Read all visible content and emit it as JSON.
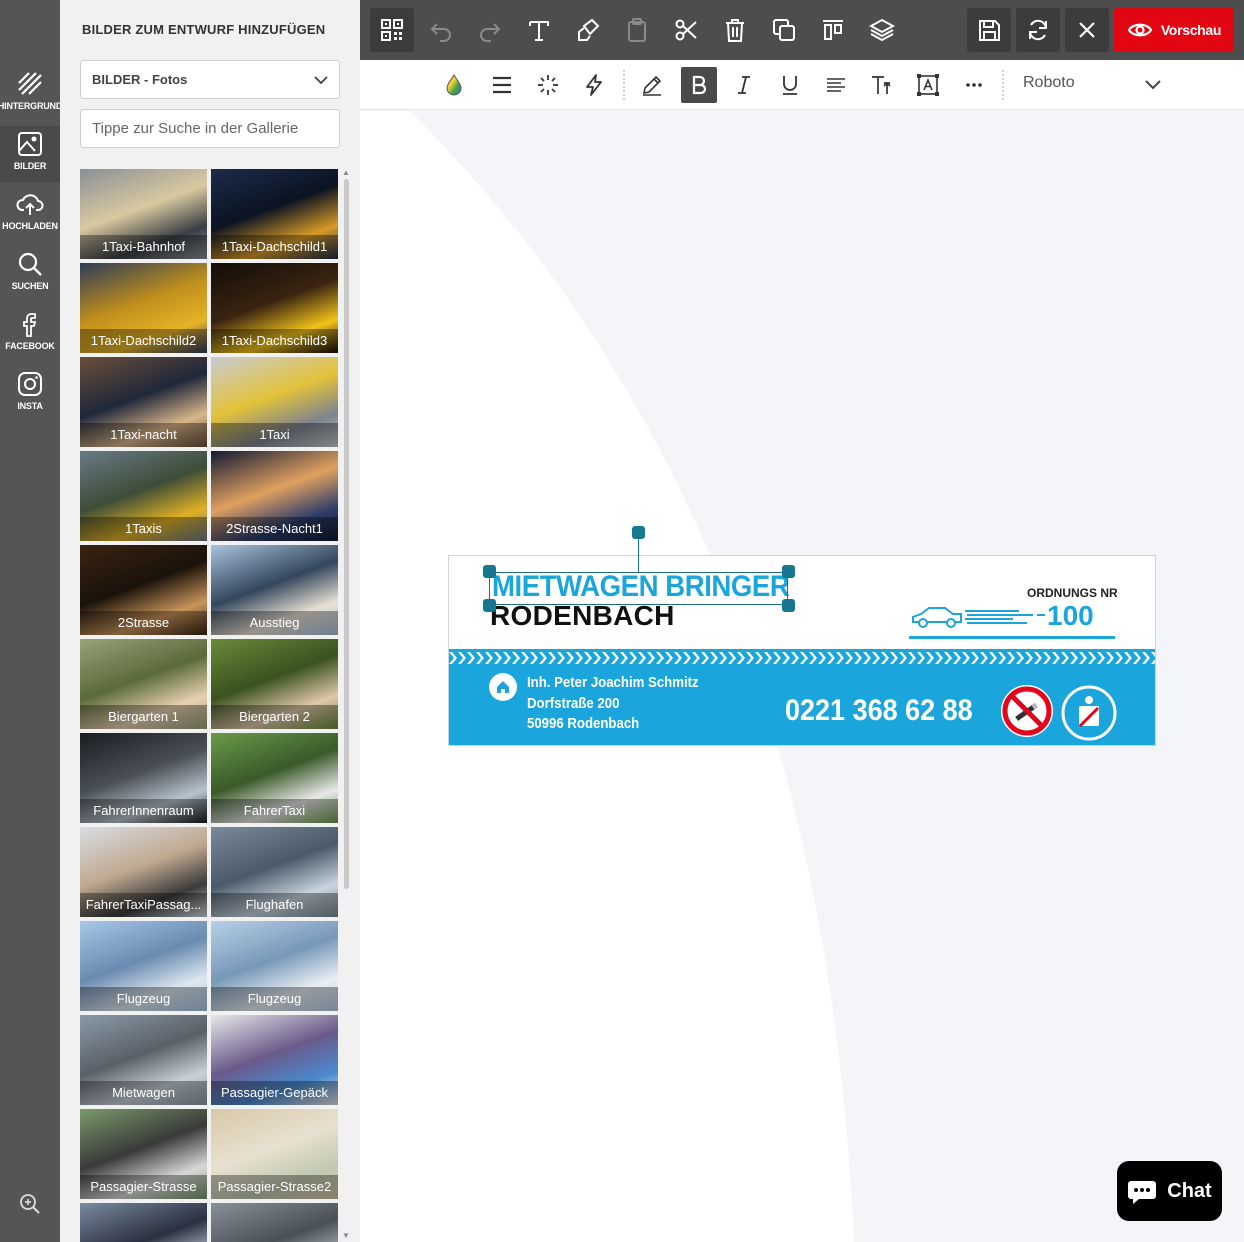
{
  "rail": {
    "items": [
      {
        "label": "HINTERGRUND",
        "icon": "background-stripes-icon"
      },
      {
        "label": "BILDER",
        "icon": "image-icon"
      },
      {
        "label": "HOCHLADEN",
        "icon": "cloud-upload-icon"
      },
      {
        "label": "SUCHEN",
        "icon": "search-icon"
      },
      {
        "label": "FACEBOOK",
        "icon": "facebook-icon"
      },
      {
        "label": "INSTA",
        "icon": "instagram-icon"
      }
    ],
    "zoom_icon": "zoom-in-icon"
  },
  "panel": {
    "title": "BILDER ZUM ENTWURF HINZUFÜGEN",
    "select_value": "BILDER - Fotos",
    "search_placeholder": "Tippe zur Suche in der Gallerie"
  },
  "gallery": [
    {
      "label": "1Taxi-Bahnhof",
      "colors": [
        "#8a8f96",
        "#3b3f45",
        "#d9c9a0"
      ]
    },
    {
      "label": "1Taxi-Dachschild1",
      "colors": [
        "#1b2c4a",
        "#d79a27",
        "#0b1322"
      ]
    },
    {
      "label": "1Taxi-Dachschild2",
      "colors": [
        "#2d3b5a",
        "#e6b326",
        "#c08f1c"
      ]
    },
    {
      "label": "1Taxi-Dachschild3",
      "colors": [
        "#120d08",
        "#f2c31b",
        "#3a2410"
      ]
    },
    {
      "label": "1Taxi-nacht",
      "colors": [
        "#6a4f3a",
        "#d9b68a",
        "#20273a"
      ]
    },
    {
      "label": "1Taxi",
      "colors": [
        "#c8ccd2",
        "#7d848d",
        "#e3c23a"
      ]
    },
    {
      "label": "1Taxis",
      "colors": [
        "#6a7a86",
        "#e0b025",
        "#3d4d38"
      ]
    },
    {
      "label": "2Strasse-Nacht1",
      "colors": [
        "#101a33",
        "#2e3e6a",
        "#e0a060"
      ]
    },
    {
      "label": "2Strasse",
      "colors": [
        "#3a2412",
        "#c9955a",
        "#1a120a"
      ]
    },
    {
      "label": "Ausstieg",
      "colors": [
        "#aac4de",
        "#e8e0d4",
        "#33465c"
      ]
    },
    {
      "label": "Biergarten 1",
      "colors": [
        "#9aa27a",
        "#e8d0b0",
        "#5a6a3a"
      ]
    },
    {
      "label": "Biergarten 2",
      "colors": [
        "#6a8a3a",
        "#e0c8a8",
        "#3a5220"
      ]
    },
    {
      "label": "FahrerInnenraum",
      "colors": [
        "#1a1c20",
        "#b8c4cc",
        "#4a5058"
      ]
    },
    {
      "label": "FahrerTaxi",
      "colors": [
        "#6a9a4a",
        "#e8e8e8",
        "#3a5a2a"
      ]
    },
    {
      "label": "FahrerTaxiPassag...",
      "colors": [
        "#d8dde2",
        "#3a3a3a",
        "#c0a890"
      ]
    },
    {
      "label": "Flughafen",
      "colors": [
        "#7a8a98",
        "#c8d4de",
        "#4a5a6a"
      ]
    },
    {
      "label": "Flugzeug",
      "colors": [
        "#a8c8e8",
        "#dde8f0",
        "#6a8ab0"
      ]
    },
    {
      "label": "Flugzeug",
      "colors": [
        "#b8d0e8",
        "#e8eef4",
        "#7898b8"
      ]
    },
    {
      "label": "Mietwagen",
      "colors": [
        "#8a9aa8",
        "#c8d0d8",
        "#5a6068"
      ]
    },
    {
      "label": "Passagier-Gepäck",
      "colors": [
        "#e8e8e8",
        "#4a8ad0",
        "#6a5a8a"
      ]
    },
    {
      "label": "Passagier-Strasse",
      "colors": [
        "#7a9a6a",
        "#d8d8d8",
        "#3a3a3a"
      ]
    },
    {
      "label": "Passagier-Strasse2",
      "colors": [
        "#d8c8a8",
        "#c0c8b0",
        "#e8e0d0"
      ]
    },
    {
      "label": "",
      "colors": [
        "#7a8aa0",
        "#c8d0dc",
        "#2a3040"
      ]
    },
    {
      "label": "",
      "colors": [
        "#8a9098",
        "#b8c0c8",
        "#4a5058"
      ]
    }
  ],
  "toolbar": {
    "icons": [
      "qr-code-icon",
      "undo-icon",
      "redo-icon",
      "text-icon",
      "copy-style-icon",
      "paste-icon",
      "cut-icon",
      "delete-icon",
      "duplicate-icon",
      "align-top-icon",
      "layers-icon",
      "save-icon",
      "refresh-icon",
      "close-icon"
    ],
    "preview_label": "Vorschau"
  },
  "format_bar": {
    "icons": [
      "color-drop-icon",
      "line-height-icon",
      "effects-icon",
      "flash-icon",
      "pen-icon",
      "bold-icon",
      "italic-icon",
      "underline-icon",
      "align-left-icon",
      "font-size-icon",
      "text-box-icon",
      "more-icon"
    ],
    "font_value": "Roboto"
  },
  "banner": {
    "title_line1": "MIETWAGEN BRINGER",
    "title_line2": "RODENBACH",
    "order_label": "ORDNUNGS NR",
    "order_number": "100",
    "owner": "Inh. Peter Joachim Schmitz",
    "street": "Dorfstraße 200",
    "city": "50996 Rodenbach",
    "phone": "0221 368 62 88",
    "accent_color": "#1aa6dc"
  },
  "chat": {
    "label": "Chat"
  },
  "colors": {
    "preview_red": "#e20612",
    "rail_bg": "#555555",
    "toolbar_bg": "#4d4d4d",
    "handle": "#17778f"
  }
}
